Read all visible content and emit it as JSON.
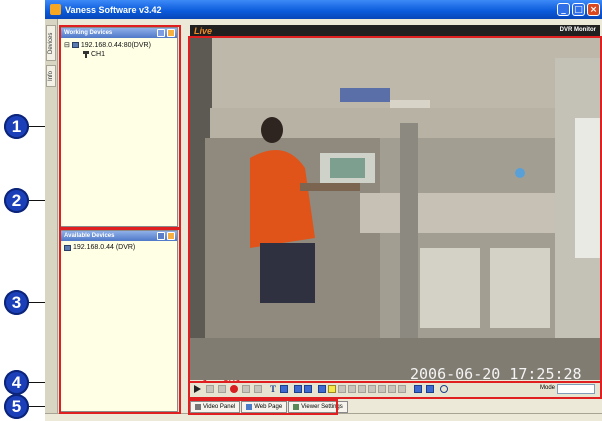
{
  "window": {
    "title": "Vaness Software v3.42"
  },
  "window_buttons": {
    "minimize": "_",
    "maximize": "□",
    "close": "×"
  },
  "side_tabs": [
    "Devices",
    "Info"
  ],
  "working_devices": {
    "title": "Working Devices",
    "device": "192.168.0.44:80(DVR)",
    "channel": "CH1"
  },
  "available_devices": {
    "title": "Available Devices",
    "device": "192.168.0.44 (DVR)"
  },
  "video": {
    "mode_label": "Live",
    "monitor_label": "DVR Monitor",
    "timestamp": "2006-06-20 17:25:28",
    "channel_osd": "1: CH1"
  },
  "toolbar": {
    "mode_label": "Mode"
  },
  "tabs": [
    "Video Panel",
    "Web Page",
    "Viewer Settings"
  ],
  "callouts": [
    "1",
    "2",
    "3",
    "4",
    "5"
  ],
  "colors": {
    "highlight": "#e02020",
    "callout": "#1a3fb8",
    "titlebar": "#0a59da"
  }
}
